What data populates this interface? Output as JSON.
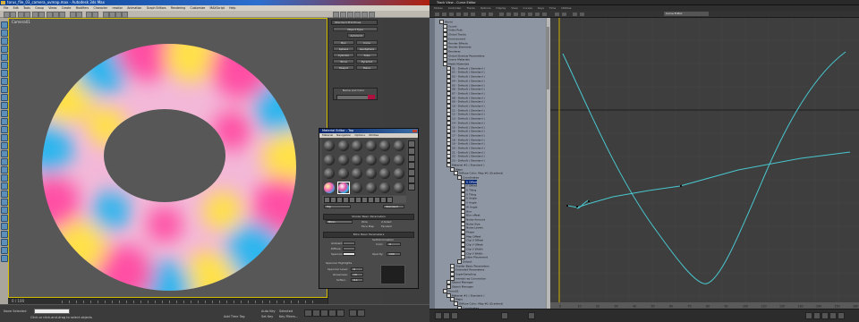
{
  "max_window": {
    "title": "torus_file_03_camera_uvmap.max  -  Autodesk 3ds Max",
    "menu": [
      "File",
      "Edit",
      "Tools",
      "Group",
      "Views",
      "Create",
      "Modifiers",
      "Character",
      "reactor",
      "Animation",
      "Graph Editors",
      "Rendering",
      "Customize",
      "MAXScript",
      "Help"
    ],
    "viewport_label": "Camera01",
    "timeline_text": "0 / 100",
    "command_panel": {
      "dropdown": "Standard Primitives",
      "rollup": "Object Type",
      "buttons": [
        "AutoGrid",
        "Box",
        "Cone",
        "Sphere",
        "GeoSphere",
        "Cylinder",
        "Tube",
        "Torus",
        "Pyramid",
        "Teapot",
        "Plane"
      ],
      "name_and_color": "Name and Color"
    },
    "status": {
      "selection": "None Selected",
      "prompt": "Click or click-and-drag to select objects",
      "auto_key": "Auto Key",
      "set_key": "Set Key",
      "key_filters": "Key Filters...",
      "add_time_tag": "Add Time Tag",
      "selected": "Selected"
    }
  },
  "material_editor": {
    "title": "Material Editor - Top",
    "menu": [
      "Material",
      "Navigation",
      "Options",
      "Utilities"
    ],
    "shader_rollup": "Shader Basic Parameters",
    "shader_type": "Blinn",
    "shader_options": [
      "Wire",
      "2-Sided",
      "Face Map",
      "Faceted"
    ],
    "blinn_rollup": "Blinn Basic Parameters",
    "self_illumination": "Self-Illumination",
    "color_label": "Color",
    "color_value": "0",
    "ambient": "Ambient:",
    "diffuse": "Diffuse:",
    "specular": "Specular:",
    "opacity_label": "Opacity:",
    "opacity_value": "100",
    "specular_highlights": "Specular Highlights",
    "specular_level": "Specular Level:",
    "glossiness": "Glossiness:",
    "soften": "Soften:",
    "specular_level_value": "0",
    "glossiness_value": "10",
    "soften_value": "0.1",
    "standard": "Standard",
    "material_name": "Top"
  },
  "curve_editor": {
    "title": "Track View - Curve Editor",
    "menu": [
      "Modes",
      "Controller",
      "Tracks",
      "Options",
      "Display",
      "View",
      "Curves",
      "Keys",
      "Time",
      "Utilities"
    ],
    "name_field": "Curve Editor",
    "tree_items": [
      {
        "label": "World",
        "indent": 1,
        "sel": false
      },
      {
        "label": "Sound",
        "indent": 2,
        "sel": false
      },
      {
        "label": "Video Post",
        "indent": 2,
        "sel": false
      },
      {
        "label": "Global Tracks",
        "indent": 2,
        "sel": false
      },
      {
        "label": "Environment",
        "indent": 2,
        "sel": false
      },
      {
        "label": "Render Effects",
        "indent": 2,
        "sel": false
      },
      {
        "label": "Render Elements",
        "indent": 2,
        "sel": false
      },
      {
        "label": "Renderer",
        "indent": 2,
        "sel": false
      },
      {
        "label": "Global Shadow Parameters",
        "indent": 2,
        "sel": false
      },
      {
        "label": "Scene Materials",
        "indent": 2,
        "sel": false
      },
      {
        "label": "Medit Materials",
        "indent": 2,
        "sel": false
      },
      {
        "label": "01 - Default ( Standard )",
        "indent": 3,
        "sel": false
      },
      {
        "label": "02 - Default ( Standard )",
        "indent": 3,
        "sel": false
      },
      {
        "label": "03 - Default ( Standard )",
        "indent": 3,
        "sel": false
      },
      {
        "label": "04 - Default ( Standard )",
        "indent": 3,
        "sel": false
      },
      {
        "label": "05 - Default ( Standard )",
        "indent": 3,
        "sel": false
      },
      {
        "label": "06 - Default ( Standard )",
        "indent": 3,
        "sel": false
      },
      {
        "label": "07 - Default ( Standard )",
        "indent": 3,
        "sel": false
      },
      {
        "label": "08 - Default ( Standard )",
        "indent": 3,
        "sel": false
      },
      {
        "label": "09 - Default ( Standard )",
        "indent": 3,
        "sel": false
      },
      {
        "label": "10 - Default ( Standard )",
        "indent": 3,
        "sel": false
      },
      {
        "label": "11 - Default ( Standard )",
        "indent": 3,
        "sel": false
      },
      {
        "label": "12 - Default ( Standard )",
        "indent": 3,
        "sel": false
      },
      {
        "label": "13 - Default ( Standard )",
        "indent": 3,
        "sel": false
      },
      {
        "label": "14 - Default ( Standard )",
        "indent": 3,
        "sel": false
      },
      {
        "label": "15 - Default ( Standard )",
        "indent": 3,
        "sel": false
      },
      {
        "label": "16 - Default ( Standard )",
        "indent": 3,
        "sel": false
      },
      {
        "label": "17 - Default ( Standard )",
        "indent": 3,
        "sel": false
      },
      {
        "label": "18 - Default ( Standard )",
        "indent": 3,
        "sel": false
      },
      {
        "label": "19 - Default ( Standard )",
        "indent": 3,
        "sel": false
      },
      {
        "label": "20 - Default ( Standard )",
        "indent": 3,
        "sel": false
      },
      {
        "label": "21 - Default ( Standard )",
        "indent": 3,
        "sel": false
      },
      {
        "label": "22 - Default ( Standard )",
        "indent": 3,
        "sel": false
      },
      {
        "label": "23 - Default ( Standard )",
        "indent": 3,
        "sel": false
      },
      {
        "label": "Material #1 ( Standard )",
        "indent": 3,
        "sel": false
      },
      {
        "label": "Maps",
        "indent": 4,
        "sel": false
      },
      {
        "label": "Diffuse Color: Map #1 (Gradient)",
        "indent": 5,
        "sel": false
      },
      {
        "label": "Coordinates",
        "indent": 6,
        "sel": false
      },
      {
        "label": "U Offset",
        "indent": 7,
        "sel": true
      },
      {
        "label": "V Offset",
        "indent": 7,
        "sel": false
      },
      {
        "label": "U Tiling",
        "indent": 7,
        "sel": false
      },
      {
        "label": "V Tiling",
        "indent": 7,
        "sel": false
      },
      {
        "label": "U Angle",
        "indent": 7,
        "sel": false
      },
      {
        "label": "V Angle",
        "indent": 7,
        "sel": false
      },
      {
        "label": "W Angle",
        "indent": 7,
        "sel": false
      },
      {
        "label": "Blur",
        "indent": 7,
        "sel": false
      },
      {
        "label": "Blur offset",
        "indent": 7,
        "sel": false
      },
      {
        "label": "Noise Amount",
        "indent": 7,
        "sel": false
      },
      {
        "label": "Noise Size",
        "indent": 7,
        "sel": false
      },
      {
        "label": "Noise Levels",
        "indent": 7,
        "sel": false
      },
      {
        "label": "Phase",
        "indent": 7,
        "sel": false
      },
      {
        "label": "Map Offset",
        "indent": 7,
        "sel": false
      },
      {
        "label": "Clip U Offset",
        "indent": 7,
        "sel": false
      },
      {
        "label": "Clip V Offset",
        "indent": 7,
        "sel": false
      },
      {
        "label": "Clip U Width",
        "indent": 7,
        "sel": false
      },
      {
        "label": "Clip V Width",
        "indent": 7,
        "sel": false
      },
      {
        "label": "Jitter Placement",
        "indent": 7,
        "sel": false
      },
      {
        "label": "Output",
        "indent": 6,
        "sel": false
      },
      {
        "label": "Shader Basic Parameters",
        "indent": 4,
        "sel": false
      },
      {
        "label": "Extended Parameters",
        "indent": 4,
        "sel": false
      },
      {
        "label": "SuperSampling",
        "indent": 4,
        "sel": false
      },
      {
        "label": "mental ray Connection",
        "indent": 4,
        "sel": false
      },
      {
        "label": "Object Manager",
        "indent": 3,
        "sel": false
      },
      {
        "label": "Object Manager",
        "indent": 3,
        "sel": false
      },
      {
        "label": "Torus01",
        "indent": 2,
        "sel": false
      },
      {
        "label": "Material #1 ( Standard )",
        "indent": 3,
        "sel": false
      },
      {
        "label": "Maps",
        "indent": 4,
        "sel": false
      },
      {
        "label": "Diffuse Color: Map #1 (Gradient)",
        "indent": 5,
        "sel": false
      },
      {
        "label": "Coordinates",
        "indent": 6,
        "sel": false
      },
      {
        "label": "U Offset",
        "indent": 7,
        "sel": true
      }
    ],
    "ruler_ticks": [
      "0",
      "10",
      "20",
      "30",
      "40",
      "50",
      "60",
      "70",
      "80",
      "90",
      "100",
      "110",
      "120",
      "130",
      "140",
      "150",
      "160"
    ]
  }
}
